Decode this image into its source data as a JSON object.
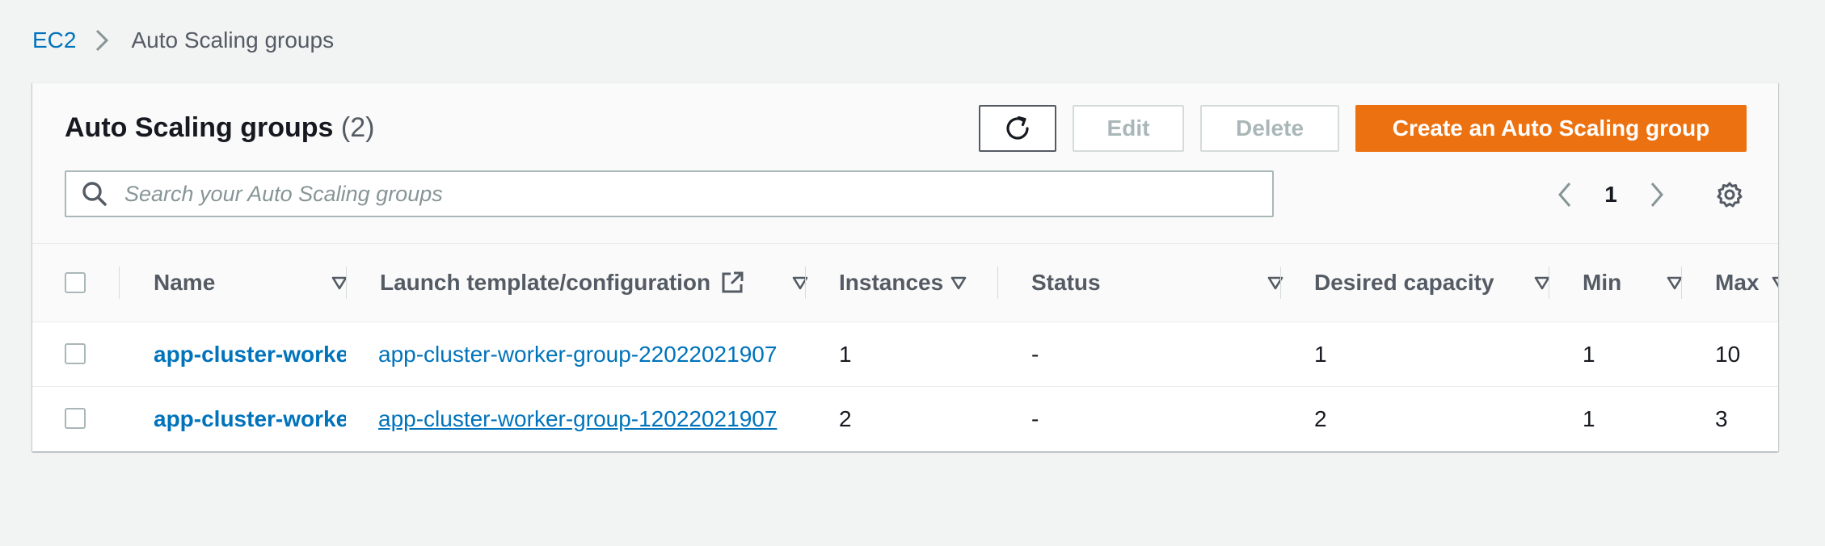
{
  "breadcrumb": {
    "root": "EC2",
    "current": "Auto Scaling groups"
  },
  "header": {
    "title": "Auto Scaling groups",
    "count": "(2)",
    "buttons": {
      "edit": "Edit",
      "delete": "Delete",
      "create": "Create an Auto Scaling group"
    }
  },
  "search": {
    "placeholder": "Search your Auto Scaling groups",
    "value": ""
  },
  "pagination": {
    "current_page": "1"
  },
  "table": {
    "columns": {
      "name": "Name",
      "launch_template": "Launch template/configuration",
      "instances": "Instances",
      "status": "Status",
      "desired_capacity": "Desired capacity",
      "min": "Min",
      "max": "Max"
    },
    "rows": [
      {
        "name": "app-cluster-worke",
        "launch_template": "app-cluster-worker-group-22022021907",
        "instances": "1",
        "status": "-",
        "desired_capacity": "1",
        "min": "1",
        "max": "10"
      },
      {
        "name": "app-cluster-worke",
        "launch_template": "app-cluster-worker-group-12022021907",
        "instances": "2",
        "status": "-",
        "desired_capacity": "2",
        "min": "1",
        "max": "3"
      }
    ]
  },
  "colors": {
    "primary": "#ec7211",
    "link": "#0073bb",
    "text": "#16191f",
    "muted": "#545b64",
    "disabled": "#aab7b8",
    "background": "#f2f3f3"
  },
  "icons": [
    "chevron-right-icon",
    "refresh-icon",
    "search-icon",
    "chevron-left-icon",
    "settings-icon",
    "external-link-icon",
    "sort-caret-icon"
  ]
}
